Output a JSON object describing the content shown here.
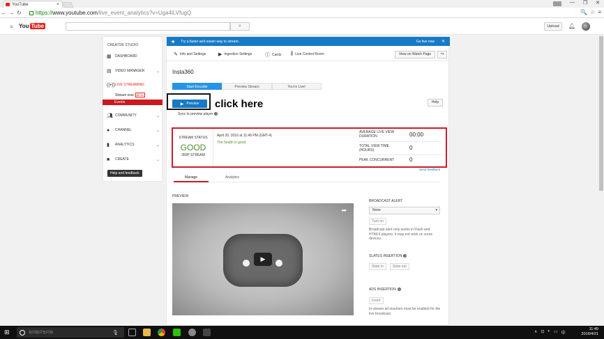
{
  "browser": {
    "tab_title": "YouTube",
    "tab_close": "×",
    "url_scheme": "https://",
    "url_host": "www.youtube.com",
    "url_path": "/live_event_analytics?v=Uga4lLVfugQ",
    "window_minimize": "—",
    "window_maximize": "❐",
    "window_close": "✕"
  },
  "header": {
    "logo_you": "You",
    "logo_tube": "Tube",
    "upload_label": "Upload"
  },
  "sidebar": {
    "title": "CREATOR STUDIO",
    "dashboard": "DASHBOARD",
    "video_manager": "VIDEO MANAGER",
    "live_streaming": "LIVE STREAMING",
    "stream_now": "Stream now",
    "beta": "BETA",
    "events": "Events",
    "community": "COMMUNITY",
    "channel": "CHANNEL",
    "analytics": "ANALYTICS",
    "create": "CREATE",
    "help_feedback": "Help and feedback"
  },
  "banner": {
    "text": "Try a faster and easier way to stream.",
    "go_live": "Go live now",
    "close": "✕"
  },
  "tabs": {
    "info_settings": "Info and Settings",
    "ingestion_settings": "Ingestion Settings",
    "cards": "Cards",
    "live_control_room": "Live Control Room",
    "view_on_watch_page": "View on Watch Page"
  },
  "event": {
    "title": "Insta360",
    "steps": [
      "Start Encoder",
      "Preview Stream",
      "You're Live!"
    ],
    "preview_button": "Preview",
    "click_here": "click here",
    "sync_label": "Sync to preview player",
    "help": "Help"
  },
  "status": {
    "stream_status_label": "STREAM STATUS",
    "stream_status_value": "GOOD",
    "resolution": "360P STREAM",
    "date": "April 20, 2016 at 11:49 PM (GMT-4)",
    "health": "The health is good.",
    "metrics": [
      {
        "label": "AVERAGE LIVE VIEW DURATION",
        "value": "00:00"
      },
      {
        "label": "TOTAL VIEW TIME (HOURS)",
        "value": "0"
      },
      {
        "label": "PEAK CONCURRENT",
        "value": "0"
      }
    ],
    "send_feedback": "Send feedback"
  },
  "subtabs": {
    "manage": "Manage",
    "analytics": "Analytics"
  },
  "preview": {
    "label": "PREVIEW"
  },
  "right": {
    "broadcast_alert": "BROADCAST ALERT",
    "alert_select": "None",
    "turn_on": "Turn on",
    "alert_note": "Broadcast alert only works in Flash and HTML5 players. It may not work on some devices.",
    "slates_insertion": "SLATES INSERTION",
    "slate_in": "Slate in",
    "slate_out": "Slate out",
    "ads_insertion": "ADS INSERTION",
    "insert": "Insert",
    "ads_note": "In-stream ad insertion must be enabled for the live broadcast."
  },
  "taskbar": {
    "search_placeholder": "有问题尽管问我",
    "time": "11:49",
    "date": "2016/4/21",
    "ime": "中"
  },
  "colors": {
    "youtube_red": "#e62117",
    "blue": "#167ac6",
    "good_green": "#4c8e2a",
    "highlight_red": "#cc1c2b"
  }
}
